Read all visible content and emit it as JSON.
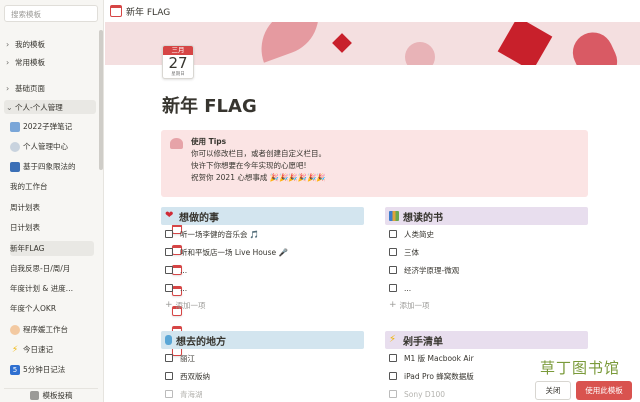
{
  "sidebar": {
    "search_placeholder": "搜索模板",
    "groups": [
      {
        "label": "我的模板"
      },
      {
        "label": "常用模板"
      },
      {
        "label": "基础页面"
      },
      {
        "label": "个人-个人管理"
      }
    ],
    "items": [
      {
        "label": "2022子弹笔记",
        "icon": "image-icon"
      },
      {
        "label": "个人管理中心",
        "icon": "cloud-icon"
      },
      {
        "label": "基于四象限法的",
        "icon": "grid-icon"
      },
      {
        "label": "我的工作台",
        "icon": "calendar-icon"
      },
      {
        "label": "周计划表",
        "icon": "calendar-icon"
      },
      {
        "label": "日计划表",
        "icon": "calendar-icon"
      },
      {
        "label": "新年FLAG",
        "icon": "calendar-icon"
      },
      {
        "label": "自我反思-日/周/月",
        "icon": "calendar-icon"
      },
      {
        "label": "年度计划 & 进度…",
        "icon": "calendar-icon"
      },
      {
        "label": "年度个人OKR",
        "icon": "calendar-icon"
      },
      {
        "label": "程序媛工作台",
        "icon": "face-icon"
      },
      {
        "label": "今日速记",
        "icon": "bolt-icon"
      },
      {
        "label": "5分钟日记法",
        "icon": "five-icon"
      }
    ],
    "submit_label": "模板投稿"
  },
  "titlebar": {
    "title": "新年 FLAG"
  },
  "calendar": {
    "month": "三月",
    "day": "27",
    "weekday": "星期日"
  },
  "page": {
    "title": "新年 FLAG"
  },
  "callout": {
    "title": "使用 Tips",
    "lines": [
      "你可以修改栏目，或者创建自定义栏目。",
      "快许下你想要在今年实现的心愿吧!",
      "祝贺你 2021 心想事成 🎉🎉🎉🎉🎉🎉"
    ]
  },
  "sections": {
    "todo": {
      "title": "想做的事",
      "items": [
        "听一场李健的音乐会 🎵",
        "听和平饭店一场 Live House 🎤",
        "...",
        "..."
      ],
      "add": "添加一项"
    },
    "books": {
      "title": "想读的书",
      "items": [
        "人类简史",
        "三体",
        "经济学原理-微观",
        "..."
      ],
      "add": "添加一项"
    },
    "places": {
      "title": "想去的地方",
      "items": [
        "丽江",
        "西双版纳",
        "青海湖"
      ]
    },
    "shopping": {
      "title": "剁手清单",
      "items": [
        "M1 版 Macbook Air",
        "iPad Pro 蜂窝数据版",
        "Sony D100"
      ]
    }
  },
  "watermark": "草丁图书馆",
  "buttons": {
    "close": "关闭",
    "use": "使用此模板"
  },
  "colors": {
    "accent": "#d9534f",
    "cover": "#f4dfe0",
    "callout": "#fbe4e4"
  }
}
